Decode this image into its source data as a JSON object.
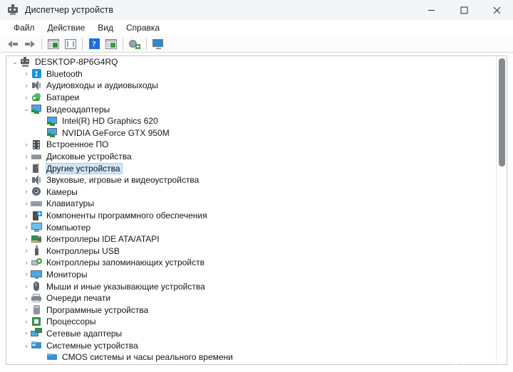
{
  "window": {
    "title": "Диспетчер устройств",
    "icon": "device-manager-icon",
    "controls": {
      "minimize": "minimize-icon",
      "maximize": "maximize-icon",
      "close": "close-icon"
    }
  },
  "menubar": {
    "items": [
      {
        "label": "Файл"
      },
      {
        "label": "Действие"
      },
      {
        "label": "Вид"
      },
      {
        "label": "Справка"
      }
    ]
  },
  "toolbar": {
    "buttons": [
      {
        "name": "back-button",
        "icon": "arrow-left-icon"
      },
      {
        "name": "forward-button",
        "icon": "arrow-right-icon"
      },
      {
        "name": "properties-button",
        "icon": "properties-window-icon"
      },
      {
        "name": "show-hidden-button",
        "icon": "book-icon"
      },
      {
        "name": "help-button",
        "icon": "help-question-icon"
      },
      {
        "name": "update-driver-button",
        "icon": "window-play-icon"
      },
      {
        "name": "scan-hardware-button",
        "icon": "gear-plus-icon"
      },
      {
        "name": "add-legacy-hardware-button",
        "icon": "monitor-icon"
      }
    ]
  },
  "tree": {
    "rows": [
      {
        "label": "DESKTOP-8P6G4RQ",
        "level": 0,
        "state": "expanded",
        "icon": "computer-root-icon",
        "selected": false
      },
      {
        "label": "Bluetooth",
        "level": 1,
        "state": "collapsed",
        "icon": "bluetooth-icon",
        "selected": false
      },
      {
        "label": "Аудиовходы и аудиовыходы",
        "level": 1,
        "state": "collapsed",
        "icon": "speaker-icon",
        "selected": false
      },
      {
        "label": "Батареи",
        "level": 1,
        "state": "collapsed",
        "icon": "battery-icon",
        "selected": false
      },
      {
        "label": "Видеоадаптеры",
        "level": 1,
        "state": "expanded",
        "icon": "display-adapter-icon",
        "selected": false
      },
      {
        "label": "Intel(R) HD Graphics 620",
        "level": 2,
        "state": "leaf",
        "icon": "display-adapter-icon",
        "selected": false
      },
      {
        "label": "NVIDIA GeForce GTX 950M",
        "level": 2,
        "state": "leaf",
        "icon": "display-adapter-icon",
        "selected": false
      },
      {
        "label": "Встроенное ПО",
        "level": 1,
        "state": "collapsed",
        "icon": "firmware-icon",
        "selected": false
      },
      {
        "label": "Дисковые устройства",
        "level": 1,
        "state": "collapsed",
        "icon": "disk-drive-icon",
        "selected": false
      },
      {
        "label": "Другие устройства",
        "level": 1,
        "state": "collapsed",
        "icon": "unknown-device-icon",
        "selected": true
      },
      {
        "label": "Звуковые, игровые и видеоустройства",
        "level": 1,
        "state": "collapsed",
        "icon": "speaker-icon",
        "selected": false
      },
      {
        "label": "Камеры",
        "level": 1,
        "state": "collapsed",
        "icon": "camera-icon",
        "selected": false
      },
      {
        "label": "Клавиатуры",
        "level": 1,
        "state": "collapsed",
        "icon": "keyboard-icon",
        "selected": false
      },
      {
        "label": "Компоненты программного обеспечения",
        "level": 1,
        "state": "collapsed",
        "icon": "software-component-icon",
        "selected": false
      },
      {
        "label": "Компьютер",
        "level": 1,
        "state": "collapsed",
        "icon": "computer-icon",
        "selected": false
      },
      {
        "label": "Контроллеры IDE ATA/ATAPI",
        "level": 1,
        "state": "collapsed",
        "icon": "ide-controller-icon",
        "selected": false
      },
      {
        "label": "Контроллеры USB",
        "level": 1,
        "state": "collapsed",
        "icon": "usb-icon",
        "selected": false
      },
      {
        "label": "Контроллеры запоминающих устройств",
        "level": 1,
        "state": "collapsed",
        "icon": "storage-controller-icon",
        "selected": false
      },
      {
        "label": "Мониторы",
        "level": 1,
        "state": "collapsed",
        "icon": "monitor-icon",
        "selected": false
      },
      {
        "label": "Мыши и иные указывающие устройства",
        "level": 1,
        "state": "collapsed",
        "icon": "mouse-icon",
        "selected": false
      },
      {
        "label": "Очереди печати",
        "level": 1,
        "state": "collapsed",
        "icon": "printer-icon",
        "selected": false
      },
      {
        "label": "Программные устройства",
        "level": 1,
        "state": "collapsed",
        "icon": "software-device-icon",
        "selected": false
      },
      {
        "label": "Процессоры",
        "level": 1,
        "state": "collapsed",
        "icon": "processor-icon",
        "selected": false
      },
      {
        "label": "Сетевые адаптеры",
        "level": 1,
        "state": "collapsed",
        "icon": "network-adapter-icon",
        "selected": false
      },
      {
        "label": "Системные устройства",
        "level": 1,
        "state": "expanded",
        "icon": "system-device-icon",
        "selected": false
      },
      {
        "label": "CMOS системы и часы реального времени",
        "level": 2,
        "state": "leaf",
        "icon": "system-device-icon",
        "selected": false
      }
    ],
    "chevron_expanded": "⌄",
    "chevron_collapsed": "›"
  },
  "scrollbar": {
    "name": "vertical-scrollbar",
    "thumb": "scrollbar-thumb"
  },
  "watermark": {
    "text": "Avito"
  },
  "colors": {
    "titlebar_bg": "#f3f6f9",
    "selection_bg": "#cfe5f8",
    "selection_border": "#a8cdec",
    "accent_blue": "#1d8fe0",
    "text": "#161616",
    "panel_border": "#c4c7ca",
    "scrollbar_thumb": "#868a8e"
  }
}
